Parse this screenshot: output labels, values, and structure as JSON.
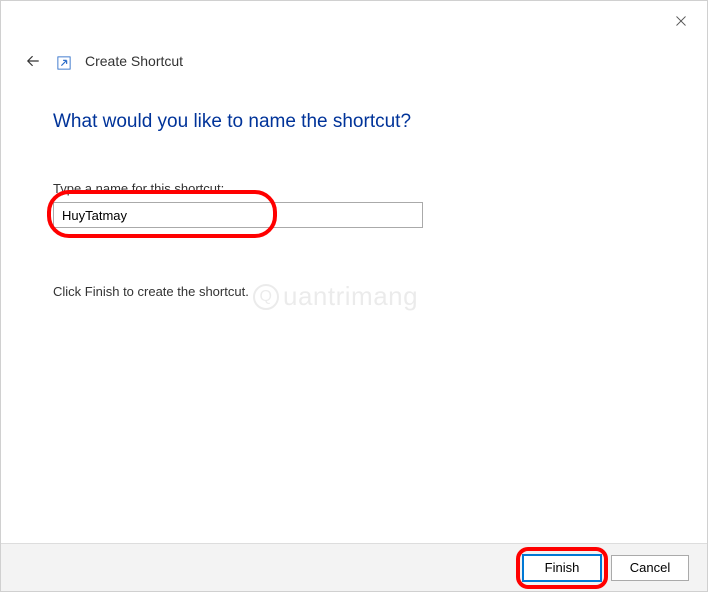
{
  "header": {
    "title": "Create Shortcut"
  },
  "main": {
    "heading": "What would you like to name the shortcut?",
    "field_label": "Type a name for this shortcut:",
    "input_value": "HuyTatmay",
    "instruction": "Click Finish to create the shortcut."
  },
  "footer": {
    "finish_label": "Finish",
    "cancel_label": "Cancel"
  },
  "watermark": {
    "text": "uantrimang"
  }
}
